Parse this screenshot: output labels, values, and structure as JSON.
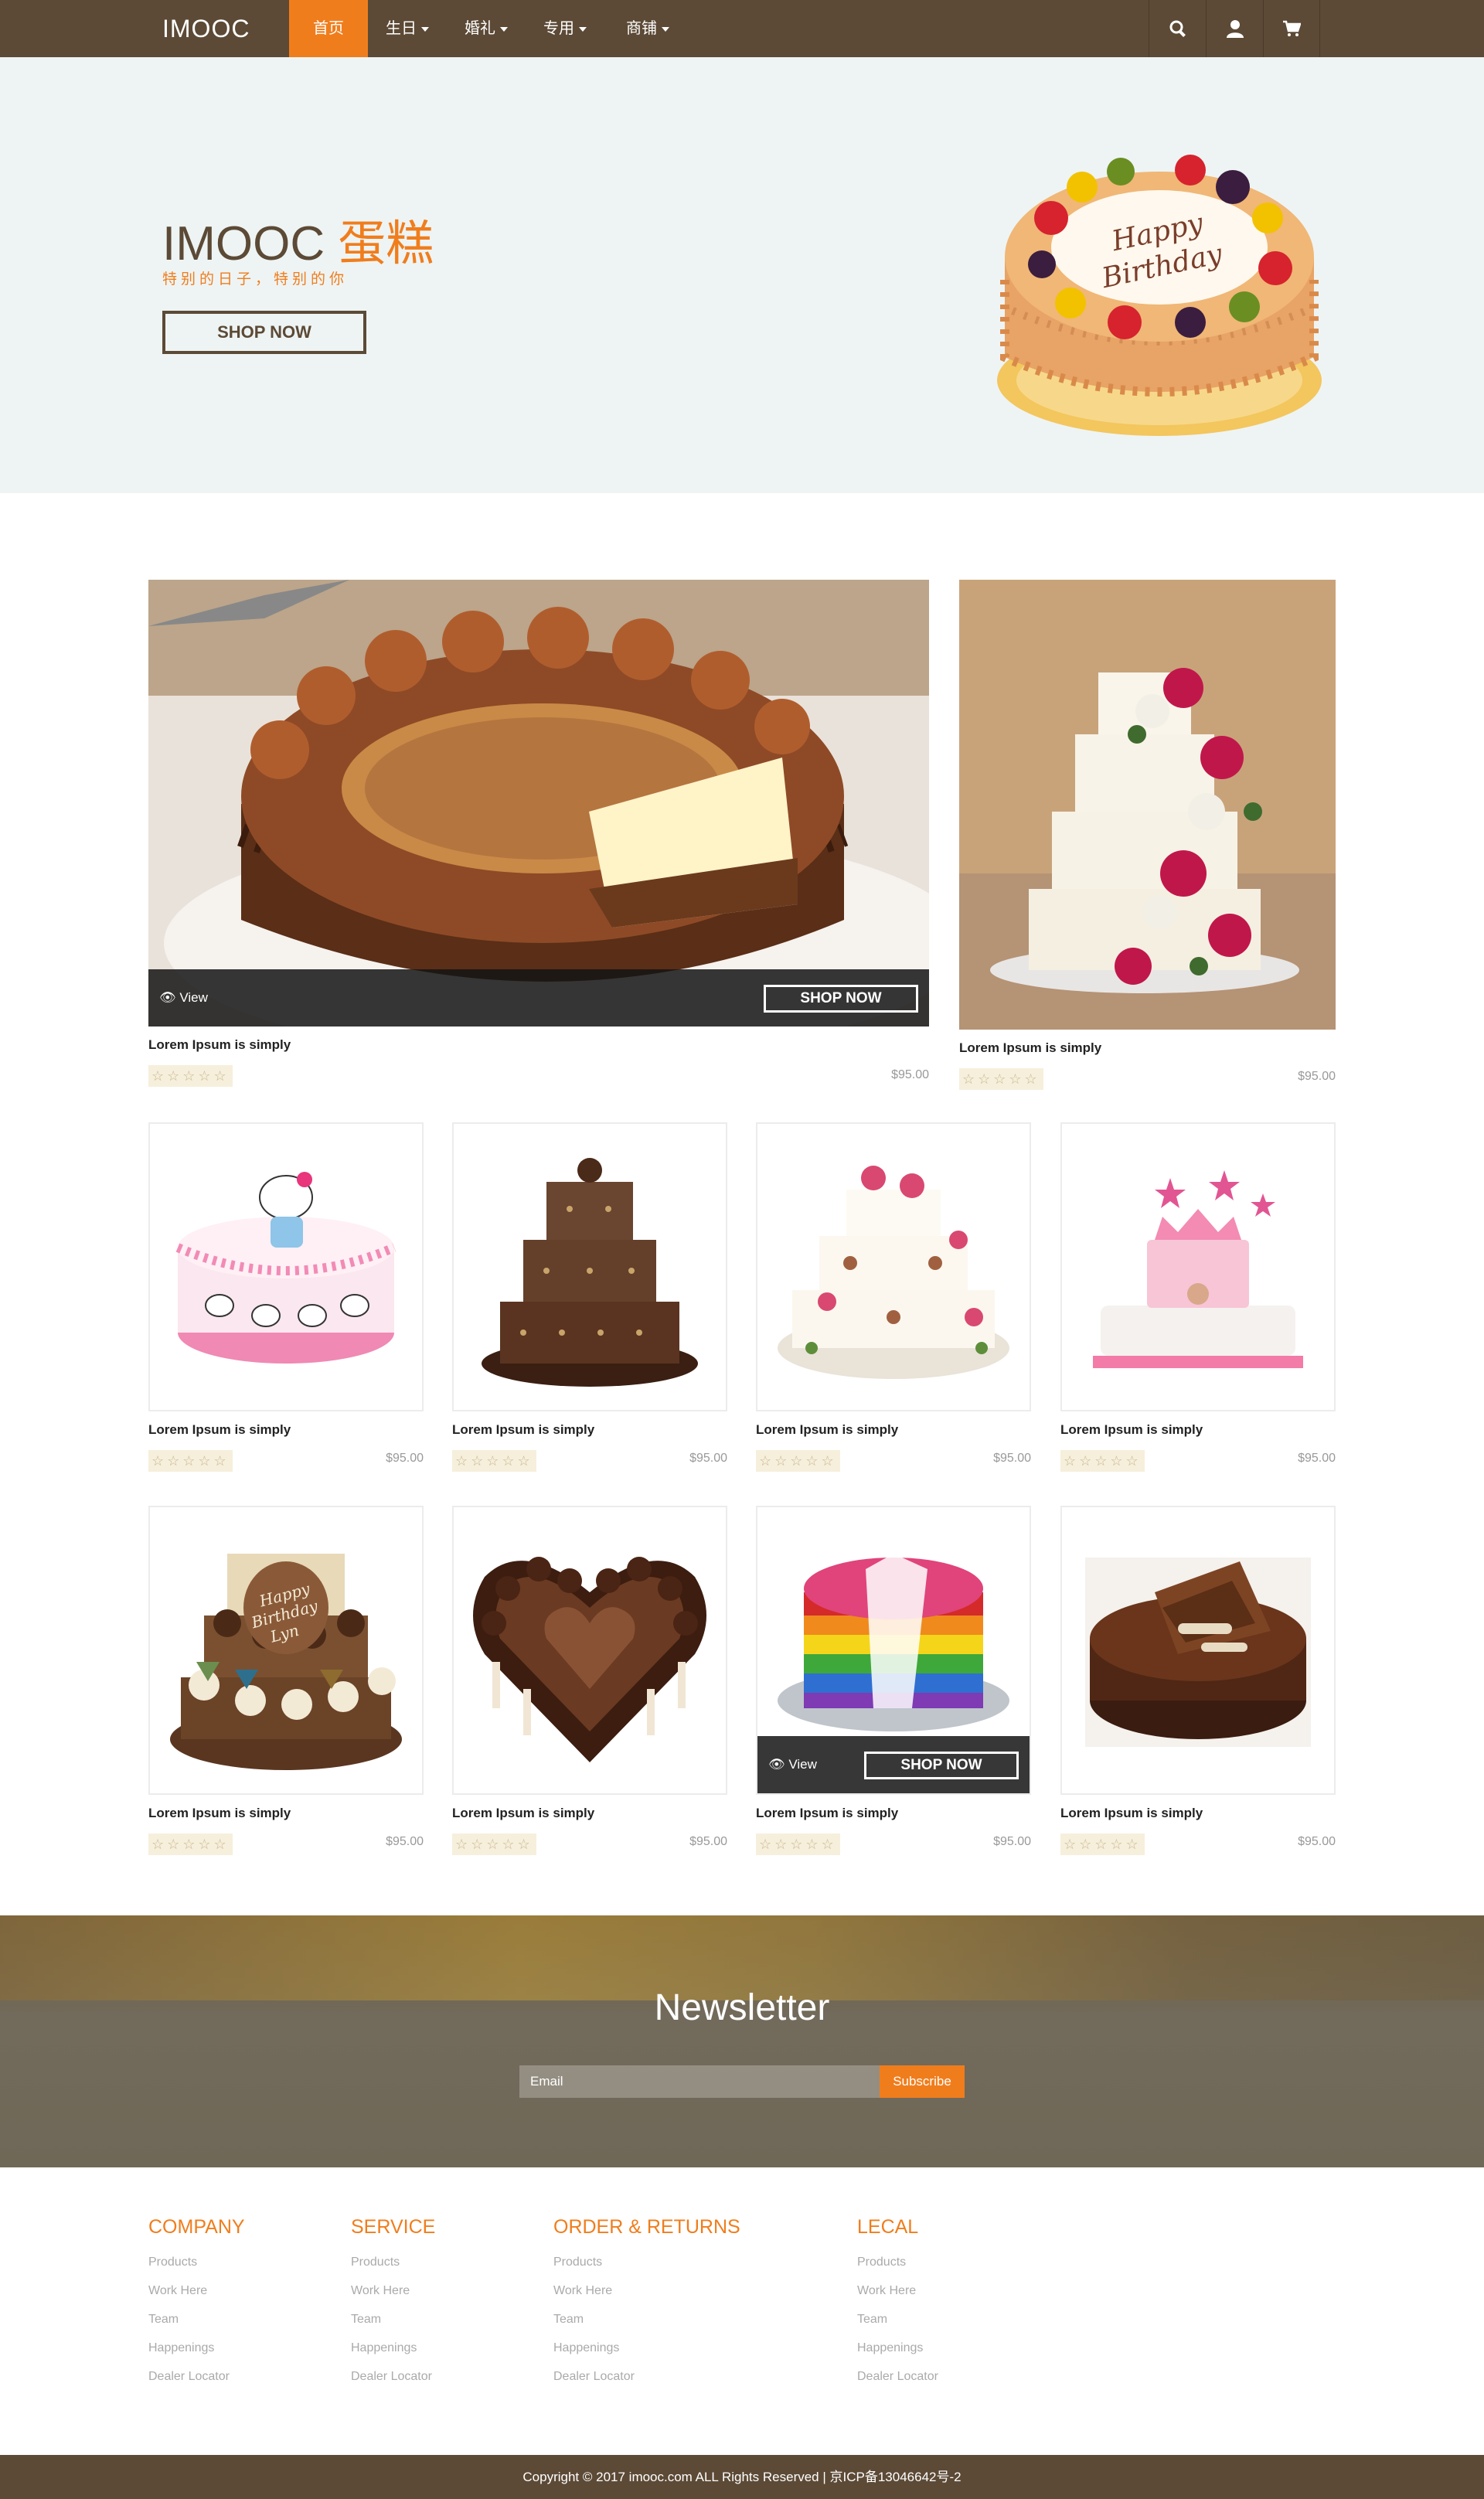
{
  "nav": {
    "brand": "IMOOC",
    "items": [
      {
        "label": "首页"
      },
      {
        "label": "生日"
      },
      {
        "label": "婚礼"
      },
      {
        "label": "专用"
      },
      {
        "label": "商铺"
      }
    ],
    "icons": [
      "search-icon",
      "user-icon",
      "cart-icon"
    ],
    "colors": {
      "bar": "#5c4a36",
      "active": "#f07d1c"
    }
  },
  "hero": {
    "title_main": "IMOOC",
    "title_accent": "蛋糕",
    "subtitle": "特别的日子，特别的你",
    "button": "SHOP NOW",
    "cake_text": "Happy Birthday",
    "background": "#eef4f4"
  },
  "featured": [
    {
      "name": "Lorem Ipsum is simply",
      "price": "$95.00",
      "stars": "☆☆☆☆☆",
      "overlay_view": "View",
      "overlay_shop": "SHOP NOW"
    },
    {
      "name": "Lorem Ipsum is simply",
      "price": "$95.00",
      "stars": "☆☆☆☆☆"
    }
  ],
  "products": [
    {
      "name": "Lorem Ipsum is simply",
      "price": "$95.00",
      "stars": "☆☆☆☆☆",
      "image": "hello-kitty-cake"
    },
    {
      "name": "Lorem Ipsum is simply",
      "price": "$95.00",
      "stars": "☆☆☆☆☆",
      "image": "chocolate-tier-cake"
    },
    {
      "name": "Lorem Ipsum is simply",
      "price": "$95.00",
      "stars": "☆☆☆☆☆",
      "image": "floral-tier-cake"
    },
    {
      "name": "Lorem Ipsum is simply",
      "price": "$95.00",
      "stars": "☆☆☆☆☆",
      "image": "pink-crown-cake"
    },
    {
      "name": "Lorem Ipsum is simply",
      "price": "$95.00",
      "stars": "☆☆☆☆☆",
      "image": "birthday-cupcake-tower",
      "cake_text": "Happy Birthday Lyn"
    },
    {
      "name": "Lorem Ipsum is simply",
      "price": "$95.00",
      "stars": "☆☆☆☆☆",
      "image": "heart-chocolate-cake"
    },
    {
      "name": "Lorem Ipsum is simply",
      "price": "$95.00",
      "stars": "☆☆☆☆☆",
      "image": "rainbow-cake",
      "overlay_view": "View",
      "overlay_shop": "SHOP NOW"
    },
    {
      "name": "Lorem Ipsum is simply",
      "price": "$95.00",
      "stars": "☆☆☆☆☆",
      "image": "chocolate-wafer-cake"
    }
  ],
  "newsletter": {
    "title": "Newsletter",
    "placeholder": "Email",
    "button": "Subscribe"
  },
  "footer": {
    "columns": [
      {
        "heading": "COMPANY",
        "links": [
          "Products",
          "Work Here",
          "Team",
          "Happenings",
          "Dealer Locator"
        ]
      },
      {
        "heading": "SERVICE",
        "links": [
          "Products",
          "Work Here",
          "Team",
          "Happenings",
          "Dealer Locator"
        ]
      },
      {
        "heading": "ORDER & RETURNS",
        "links": [
          "Products",
          "Work Here",
          "Team",
          "Happenings",
          "Dealer Locator"
        ]
      },
      {
        "heading": "LECAL",
        "links": [
          "Products",
          "Work Here",
          "Team",
          "Happenings",
          "Dealer Locator"
        ]
      }
    ],
    "copyright": "Copyright © 2017 imooc.com ALL Rights Reserved | 京ICP备13046642号-2"
  }
}
